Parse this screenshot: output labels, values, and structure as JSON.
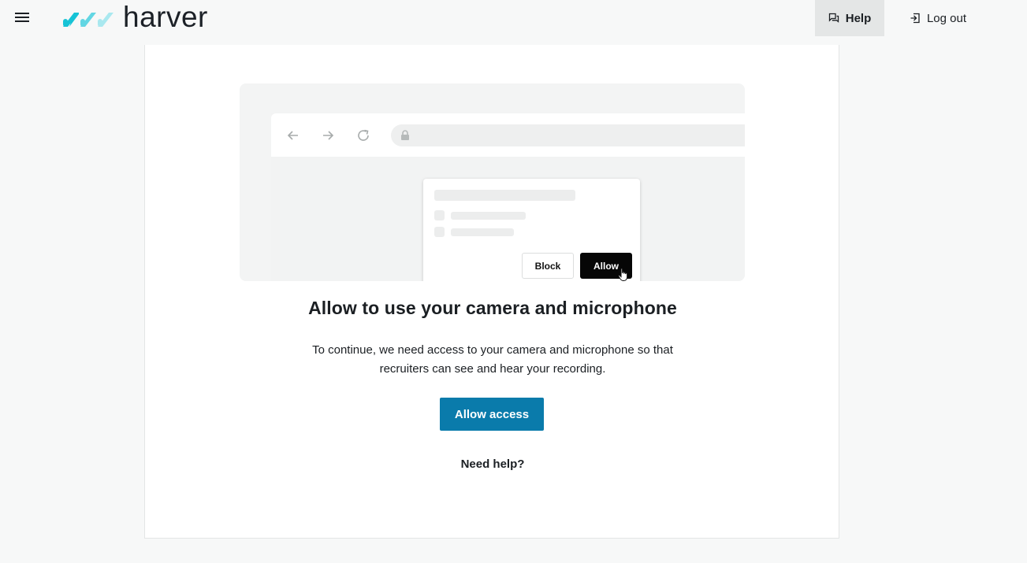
{
  "header": {
    "logo_text": "harver",
    "help_label": "Help",
    "logout_label": "Log out",
    "brand_colors": [
      "#17c3d6",
      "#62d6e3",
      "#a9e8ef"
    ]
  },
  "illustration": {
    "block_label": "Block",
    "allow_label": "Allow"
  },
  "main": {
    "title": "Allow to use your camera and microphone",
    "description": "To continue, we need access to your camera and microphone so that recruiters can see and hear your recording.",
    "allow_access_label": "Allow access",
    "need_help_label": "Need help?",
    "accent_color": "#0a7bab"
  }
}
